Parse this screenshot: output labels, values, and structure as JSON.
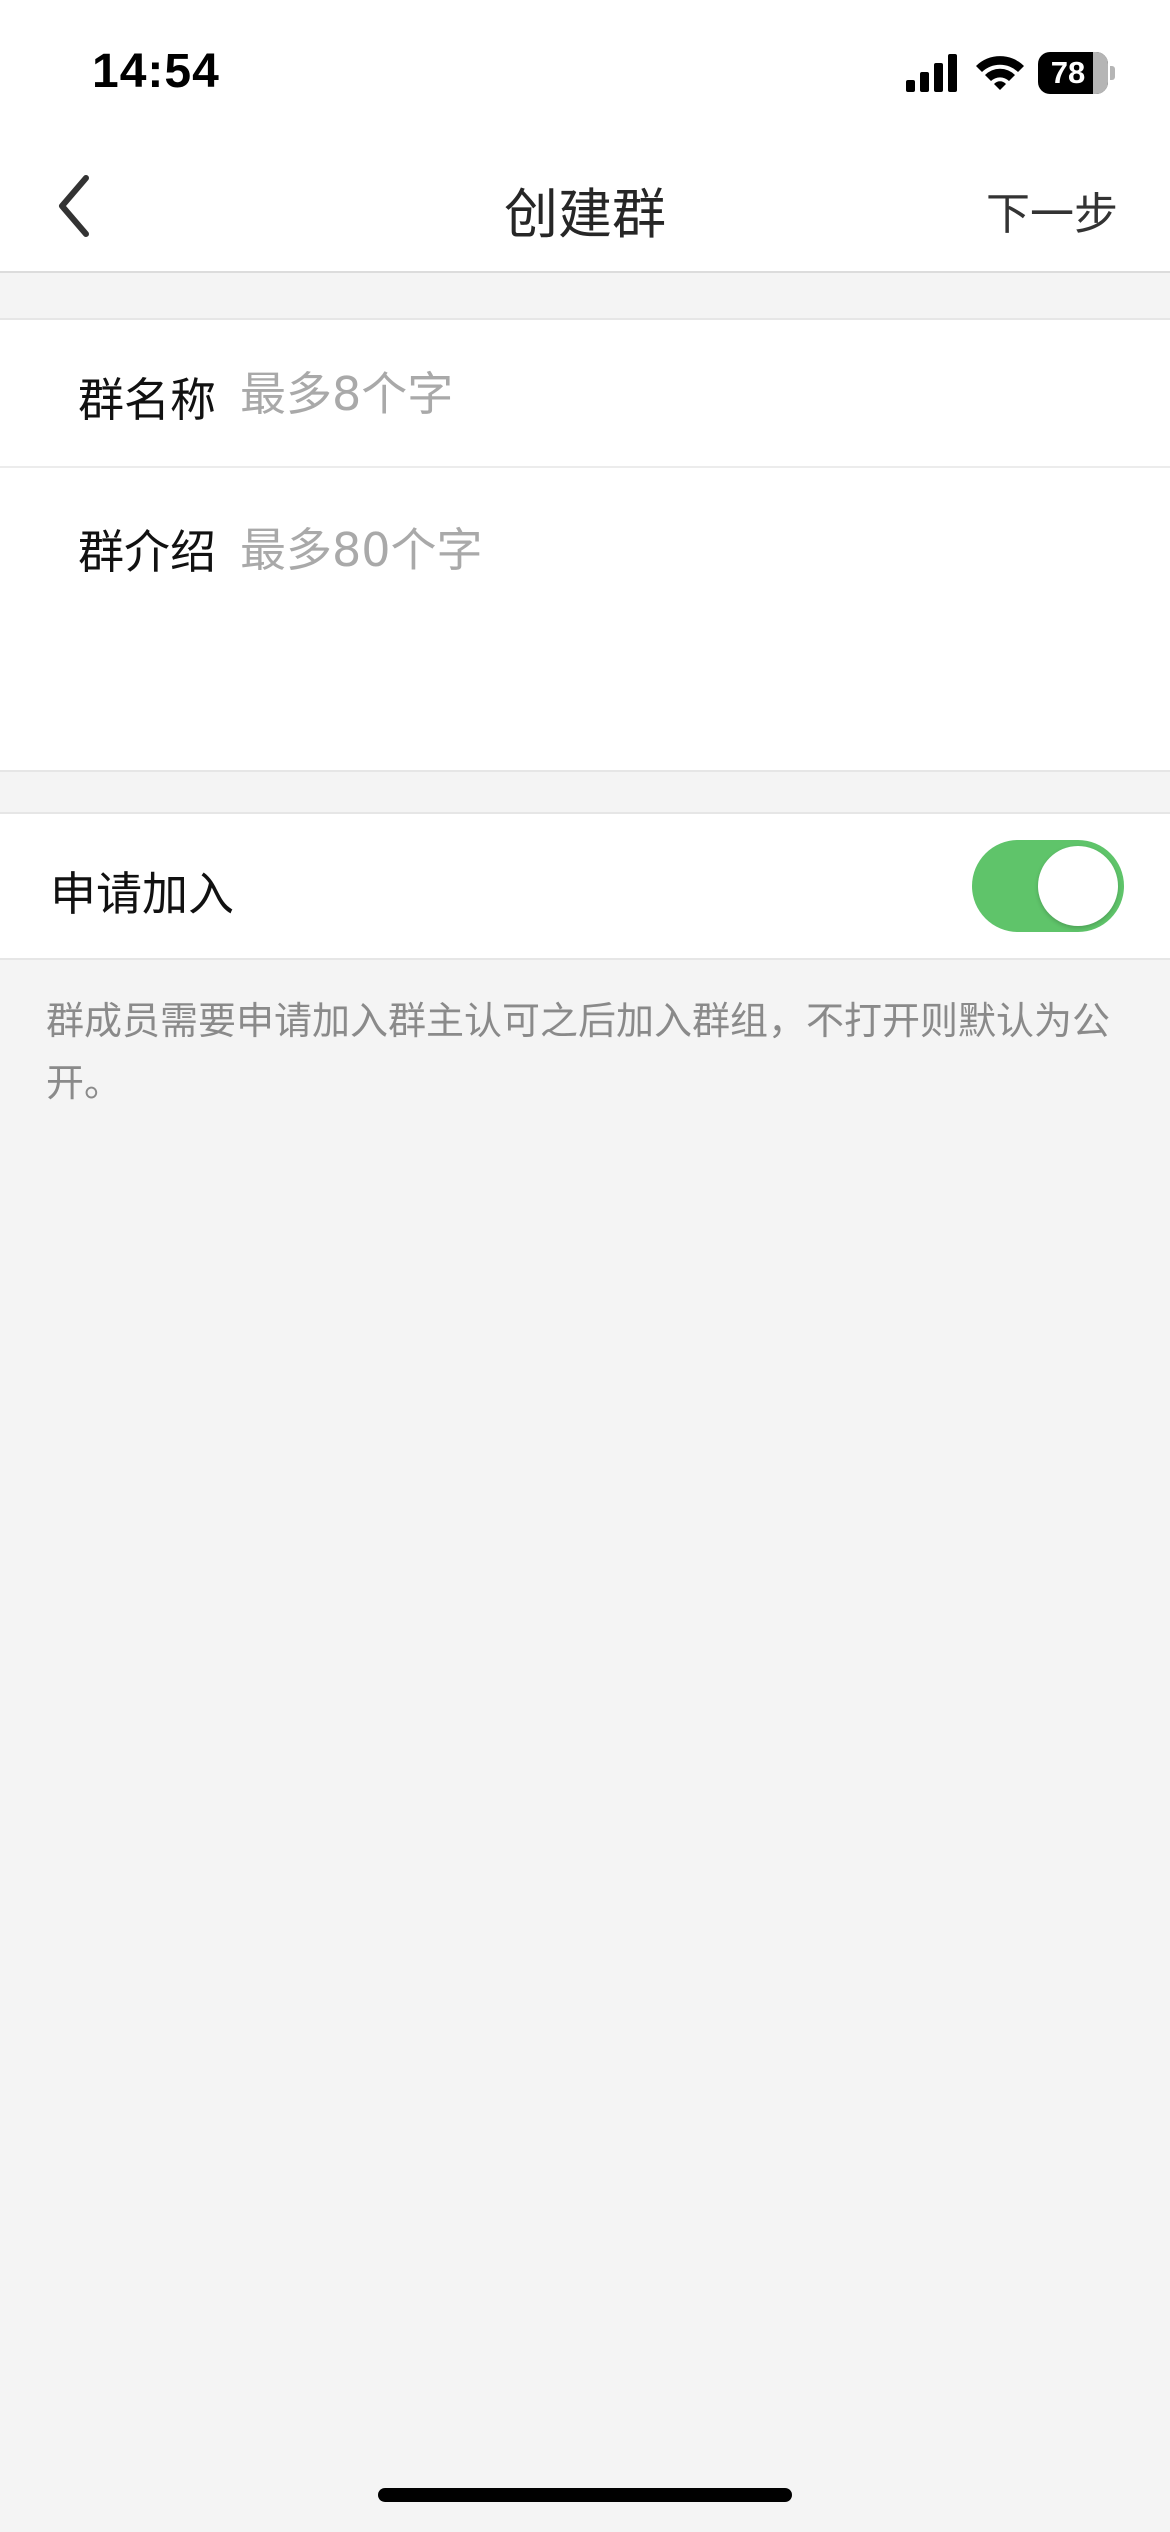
{
  "status_bar": {
    "time": "14:54",
    "battery": "78",
    "icons": [
      "signal-icon",
      "wifi-icon",
      "battery-icon"
    ]
  },
  "nav": {
    "back_icon": "chevron-left-icon",
    "title": "创建群",
    "next_label": "下一步"
  },
  "form": {
    "group_name": {
      "label": "群名称",
      "value": "",
      "placeholder": "最多8个字"
    },
    "group_intro": {
      "label": "群介绍",
      "value": "",
      "placeholder": "最多80个字"
    }
  },
  "join_request": {
    "label": "申请加入",
    "enabled": true,
    "accent_color": "#5fc46a"
  },
  "helper_text": "群成员需要申请加入群主认可之后加入群组，不打开则默认为公开。"
}
